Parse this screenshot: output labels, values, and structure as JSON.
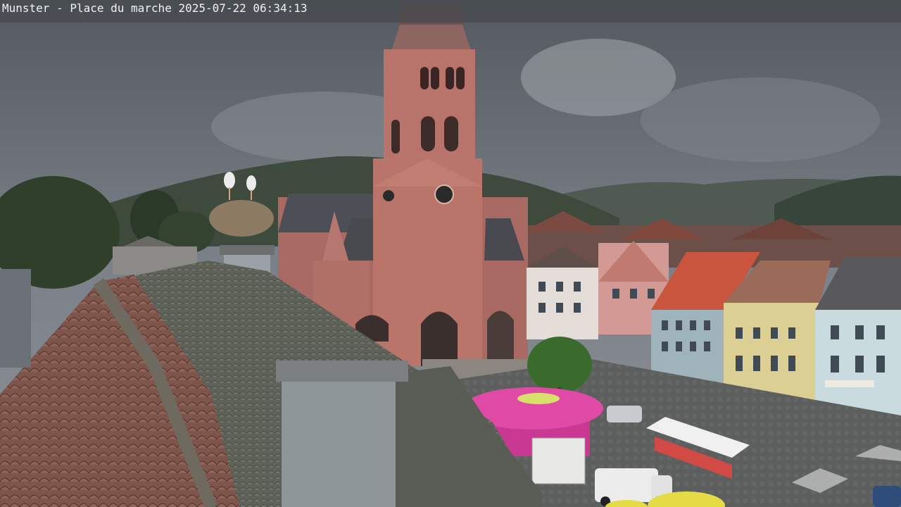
{
  "overlay": {
    "caption": "Munster - Place du marche 2025-07-22 06:34:13"
  },
  "scene": {
    "sky_color": "#6f757c",
    "church_color": "#b56a62",
    "hill_color": "#3f4a3d",
    "roof_tile_color": "#7a5348",
    "market_tent_color": "#d23b9a",
    "icons": [
      "church-tower",
      "storks-nest",
      "market-tent",
      "delivery-van"
    ]
  }
}
